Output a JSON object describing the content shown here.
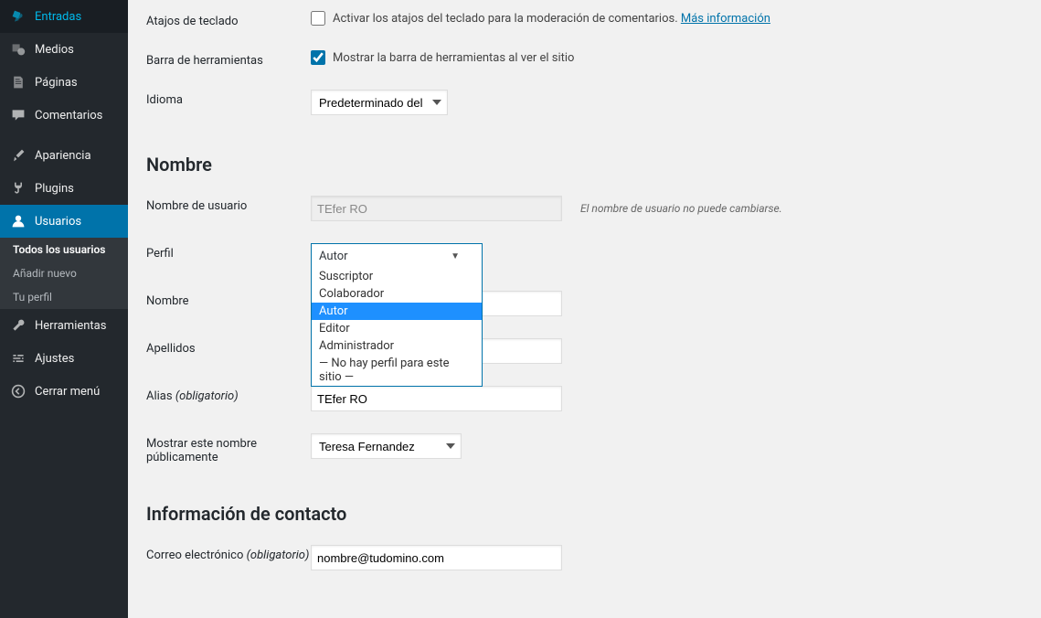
{
  "sidebar": {
    "items": [
      {
        "label": "Entradas",
        "icon": "pin"
      },
      {
        "label": "Medios",
        "icon": "media"
      },
      {
        "label": "Páginas",
        "icon": "page"
      },
      {
        "label": "Comentarios",
        "icon": "comment"
      },
      {
        "label": "Apariencia",
        "icon": "brush"
      },
      {
        "label": "Plugins",
        "icon": "plug"
      },
      {
        "label": "Usuarios",
        "icon": "user",
        "active": true
      },
      {
        "label": "Herramientas",
        "icon": "wrench"
      },
      {
        "label": "Ajustes",
        "icon": "sliders"
      },
      {
        "label": "Cerrar menú",
        "icon": "collapse"
      }
    ],
    "submenu": [
      "Todos los usuarios",
      "Añadir nuevo",
      "Tu perfil"
    ]
  },
  "form": {
    "shortcuts_label": "Atajos de teclado",
    "shortcuts_text": "Activar los atajos del teclado para la moderación de comentarios. ",
    "shortcuts_link": "Más información",
    "toolbar_label": "Barra de herramientas",
    "toolbar_text": "Mostrar la barra de herramientas al ver el sitio",
    "language_label": "Idioma",
    "language_value": "Predeterminado del sitio",
    "section_name": "Nombre",
    "username_label": "Nombre de usuario",
    "username_value": "TEfer RO",
    "username_hint": "El nombre de usuario no puede cambiarse.",
    "role_label": "Perfil",
    "role_selected": "Autor",
    "role_options": [
      "Suscriptor",
      "Colaborador",
      "Autor",
      "Editor",
      "Administrador",
      "— No hay perfil para este sitio —"
    ],
    "firstname_label": "Nombre",
    "lastname_label": "Apellidos",
    "alias_label": "Alias ",
    "alias_req": "(obligatorio)",
    "alias_value": "TEfer RO",
    "displayname_label": "Mostrar este nombre públicamente",
    "displayname_value": "Teresa Fernandez",
    "section_contact": "Información de contacto",
    "email_label": "Correo electrónico ",
    "email_req": "(obligatorio)",
    "email_value": "nombre@tudomino.com"
  }
}
